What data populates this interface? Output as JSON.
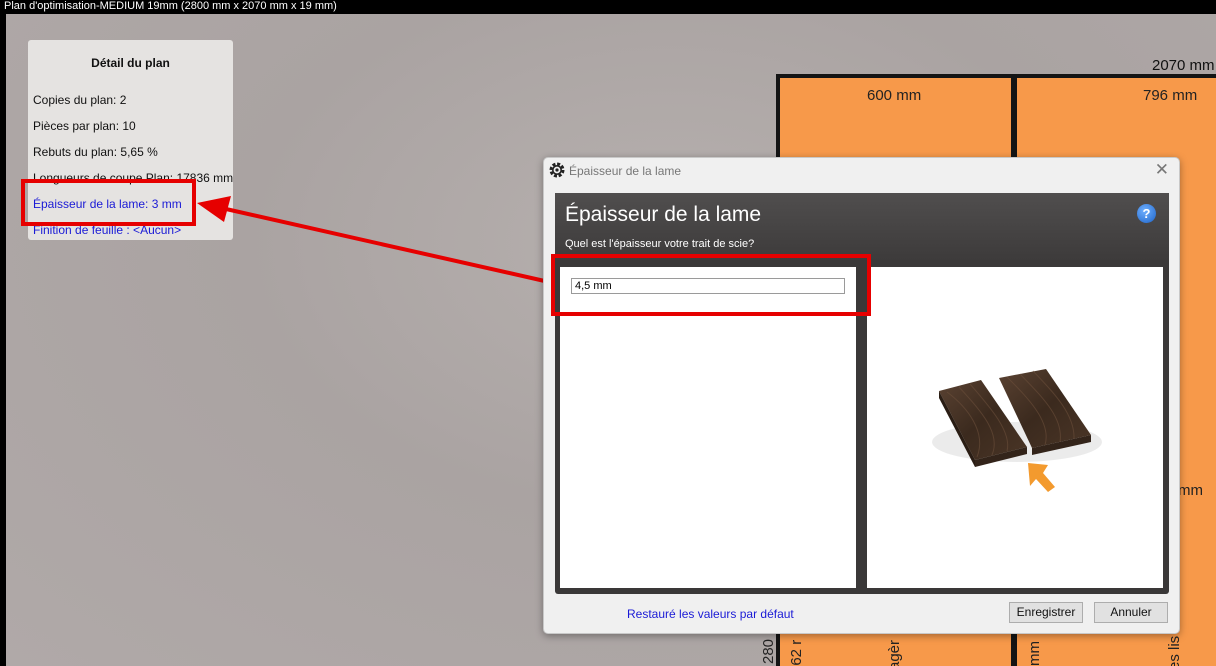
{
  "window": {
    "title": "Plan d'optimisation-MEDIUM 19mm (2800 mm x 2070 mm x 19 mm)"
  },
  "plan": {
    "dimension_top": "2070 mm",
    "pieces": [
      {
        "label": "600 mm"
      },
      {
        "label": "796 mm"
      }
    ],
    "partial_labels": [
      "mm",
      "280",
      "362 r",
      "agèr",
      "mm",
      "es lis"
    ]
  },
  "detail": {
    "title": "Détail du plan",
    "copies": "Copies du plan: 2",
    "pieces": "Pièces par plan: 10",
    "rebuts": "Rebuts du plan: 5,65 %",
    "longueurs": "Longueurs de coupe Plan: 17836 mm",
    "epaisseur_link": "Épaisseur de la lame: 3 mm",
    "finition_link": "Finition de feuille :  <Aucun>"
  },
  "dialog": {
    "window_title": "Épaisseur de la lame",
    "heading": "Épaisseur de la lame",
    "question": "Quel est l'épaisseur votre trait de scie?",
    "help_label": "?",
    "input_value": "4,5 mm",
    "restore_link": "Restauré les valeurs par défaut",
    "save_label": "Enregistrer",
    "cancel_label": "Annuler",
    "close_label": "✕"
  },
  "colors": {
    "piece": "#f7994a",
    "highlight": "#e60000",
    "link": "#1a1ad6"
  }
}
